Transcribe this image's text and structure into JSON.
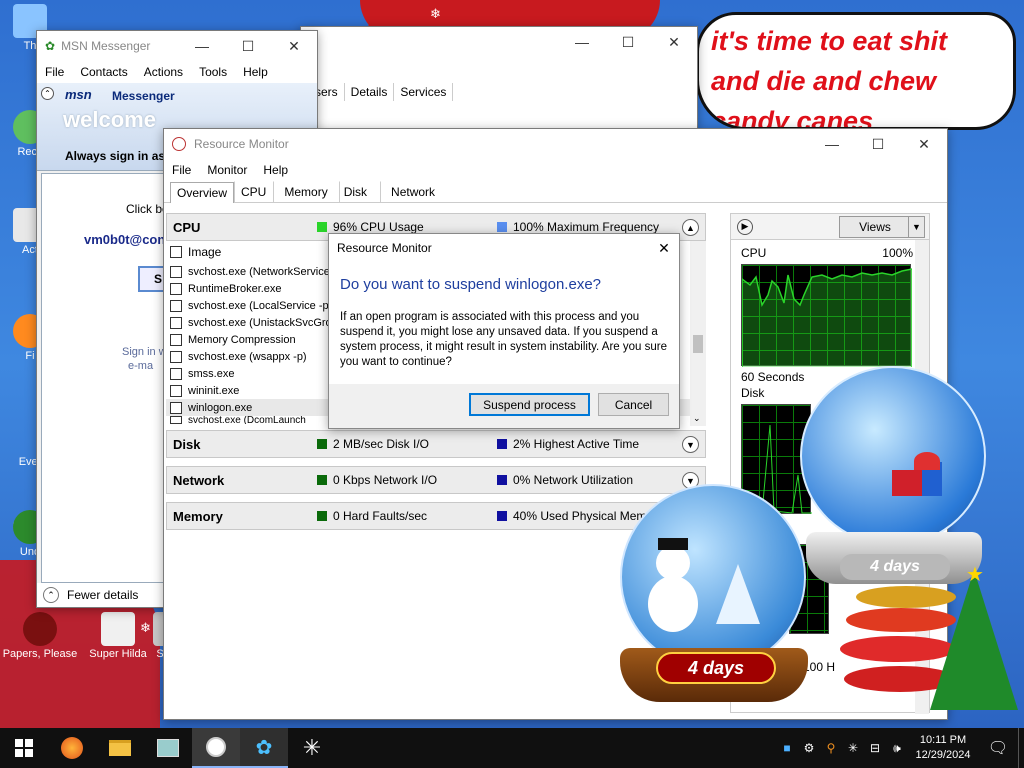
{
  "desktop": {
    "icons": [
      {
        "label": "Th"
      },
      {
        "label": "Recy"
      },
      {
        "label": "Act"
      },
      {
        "label": "Fi"
      },
      {
        "label": "Ever"
      },
      {
        "label": "Und"
      },
      {
        "label": "Papers, Please"
      },
      {
        "label": "Super Hilda"
      },
      {
        "label": "S"
      }
    ],
    "speech_bubble": {
      "line1": "it's time to eat shit",
      "line2": "and die and chew",
      "line3": "candy canes"
    },
    "globes": [
      {
        "label": "4 days"
      },
      {
        "label": "4 days"
      }
    ]
  },
  "msn": {
    "title": "MSN Messenger",
    "menu": [
      "File",
      "Contacts",
      "Actions",
      "Tools",
      "Help"
    ],
    "brand": "msn",
    "brand_sub": "Messenger",
    "welcome": "welcome",
    "always_sign": "Always sign in as:",
    "click_text": "Click bel",
    "email": "vm0b0t@con",
    "signin_btn": "S",
    "sign_text": "Sign in w",
    "email_text": "e-ma"
  },
  "taskmgr": {
    "tabs": [
      "sers",
      "Details",
      "Services"
    ],
    "fewer_details": "Fewer details"
  },
  "resmon": {
    "title": "Resource Monitor",
    "menu": [
      "File",
      "Monitor",
      "Help"
    ],
    "tabs": [
      "Overview",
      "CPU",
      "Memory",
      "Disk",
      "Network"
    ],
    "cpu": {
      "name": "CPU",
      "m1": "96% CPU Usage",
      "m2": "100% Maximum Frequency"
    },
    "image_header": "Image",
    "processes": [
      "svchost.exe (NetworkService",
      "RuntimeBroker.exe",
      "svchost.exe (LocalService -p)",
      "svchost.exe (UnistackSvcGro",
      "Memory Compression",
      "svchost.exe (wsappx -p)",
      "smss.exe",
      "wininit.exe",
      "winlogon.exe",
      "svchost.exe (DcomLaunch"
    ],
    "disk": {
      "name": "Disk",
      "m1": "2 MB/sec Disk I/O",
      "m2": "2% Highest Active Time"
    },
    "network": {
      "name": "Network",
      "m1": "0 Kbps Network I/O",
      "m2": "0% Network Utilization"
    },
    "memory": {
      "name": "Memory",
      "m1": "0 Hard Faults/sec",
      "m2": "40% Used Physical Memo"
    },
    "views_label": "Views",
    "cpu_graph_label": "CPU",
    "cpu_graph_pct": "100%",
    "seconds_label": "60 Seconds",
    "disk_graph_label": "Disk",
    "net_pct": "100 H"
  },
  "dialog": {
    "title": "Resource Monitor",
    "heading": "Do you want to suspend winlogon.exe?",
    "body": "If an open program is associated with this process and you suspend it, you might lose any unsaved data. If you suspend a system process, it might result in system instability. Are you sure you want to continue?",
    "ok": "Suspend process",
    "cancel": "Cancel"
  },
  "taskbar": {
    "time": "10:11 PM",
    "date": "12/29/2024"
  },
  "colors": {
    "cpu_green": "#2ad42a",
    "cpu_blue": "#5a8ff0",
    "dark_green": "#0a6a0a",
    "dark_blue": "#1010a0",
    "dialog_heading": "#1f3f9f",
    "bubble_red": "#e0101a"
  }
}
